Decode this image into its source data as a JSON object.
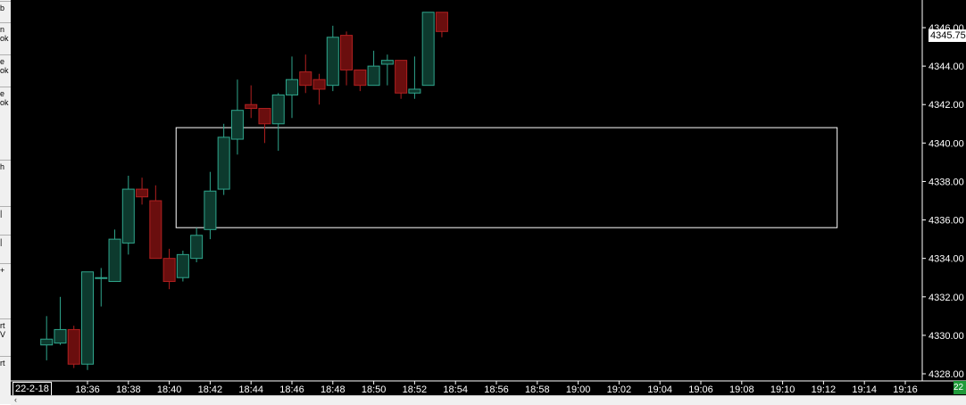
{
  "toolbar": {
    "items": [
      "b",
      "n\nok",
      "e\nok",
      "e\nok",
      "h",
      "|",
      "|",
      "+",
      "rt\nV",
      "rt"
    ]
  },
  "date_label": "22-2-18",
  "current_price_label": "4345.75",
  "corner_tag": "22",
  "colors": {
    "background": "#000000",
    "up_fill": "#0d3a2e",
    "up_border": "#2fa58c",
    "down_fill": "#6a0e0e",
    "down_border": "#b02020",
    "axis_text": "#ffffff",
    "zone_border": "#ffffff"
  },
  "chart_data": {
    "type": "candlestick",
    "title": "",
    "xlabel": "",
    "ylabel": "",
    "ylim": [
      4327.5,
      4346.5
    ],
    "x_ticks": [
      "18:36",
      "18:38",
      "18:40",
      "18:42",
      "18:44",
      "18:46",
      "18:48",
      "18:50",
      "18:52",
      "18:54",
      "18:56",
      "18:58",
      "19:00",
      "19:02",
      "19:04",
      "19:06",
      "19:08",
      "19:10",
      "19:12",
      "19:14",
      "19:16"
    ],
    "y_ticks": [
      "4328.00",
      "4330.00",
      "4332.00",
      "4334.00",
      "4336.00",
      "4338.00",
      "4340.00",
      "4342.00",
      "4344.00",
      "4346.00"
    ],
    "grid": false,
    "candles": [
      {
        "time": "18:34:00",
        "open": 4329.5,
        "high": 4331.0,
        "low": 4328.7,
        "close": 4329.8
      },
      {
        "time": "18:34:40",
        "open": 4329.6,
        "high": 4332.0,
        "low": 4329.5,
        "close": 4330.3
      },
      {
        "time": "18:35:20",
        "open": 4330.3,
        "high": 4330.5,
        "low": 4328.3,
        "close": 4328.5
      },
      {
        "time": "18:36:00",
        "open": 4328.5,
        "high": 4333.3,
        "low": 4328.2,
        "close": 4333.3
      },
      {
        "time": "18:36:40",
        "open": 4333.0,
        "high": 4333.5,
        "low": 4331.5,
        "close": 4333.0
      },
      {
        "time": "18:37:20",
        "open": 4332.8,
        "high": 4335.5,
        "low": 4332.8,
        "close": 4335.0
      },
      {
        "time": "18:38:00",
        "open": 4334.8,
        "high": 4338.3,
        "low": 4334.2,
        "close": 4337.6
      },
      {
        "time": "18:38:40",
        "open": 4337.6,
        "high": 4338.2,
        "low": 4336.8,
        "close": 4337.2
      },
      {
        "time": "18:39:20",
        "open": 4337.0,
        "high": 4337.8,
        "low": 4335.5,
        "close": 4334.0
      },
      {
        "time": "18:40:00",
        "open": 4334.0,
        "high": 4334.5,
        "low": 4332.4,
        "close": 4332.8
      },
      {
        "time": "18:40:40",
        "open": 4333.0,
        "high": 4334.4,
        "low": 4332.8,
        "close": 4334.2
      },
      {
        "time": "18:41:20",
        "open": 4334.0,
        "high": 4335.6,
        "low": 4333.8,
        "close": 4335.2
      },
      {
        "time": "18:42:00",
        "open": 4335.5,
        "high": 4338.5,
        "low": 4335.0,
        "close": 4337.5
      },
      {
        "time": "18:42:40",
        "open": 4337.6,
        "high": 4341.0,
        "low": 4337.3,
        "close": 4340.3
      },
      {
        "time": "18:43:20",
        "open": 4340.2,
        "high": 4343.3,
        "low": 4339.4,
        "close": 4341.7
      },
      {
        "time": "18:44:00",
        "open": 4342.0,
        "high": 4343.0,
        "low": 4341.3,
        "close": 4341.8
      },
      {
        "time": "18:44:40",
        "open": 4341.8,
        "high": 4341.8,
        "low": 4340.0,
        "close": 4341.0
      },
      {
        "time": "18:45:20",
        "open": 4341.0,
        "high": 4342.6,
        "low": 4339.6,
        "close": 4342.5
      },
      {
        "time": "18:46:00",
        "open": 4342.5,
        "high": 4344.5,
        "low": 4341.3,
        "close": 4343.3
      },
      {
        "time": "18:46:40",
        "open": 4343.7,
        "high": 4344.6,
        "low": 4342.6,
        "close": 4343.0
      },
      {
        "time": "18:47:20",
        "open": 4343.3,
        "high": 4343.6,
        "low": 4342.0,
        "close": 4342.8
      },
      {
        "time": "18:48:00",
        "open": 4343.0,
        "high": 4346.1,
        "low": 4342.7,
        "close": 4345.5
      },
      {
        "time": "18:48:40",
        "open": 4345.6,
        "high": 4345.8,
        "low": 4343.0,
        "close": 4343.8
      },
      {
        "time": "18:49:20",
        "open": 4343.8,
        "high": 4343.8,
        "low": 4342.7,
        "close": 4343.0
      },
      {
        "time": "18:50:00",
        "open": 4343.0,
        "high": 4344.8,
        "low": 4343.0,
        "close": 4344.0
      },
      {
        "time": "18:50:40",
        "open": 4344.1,
        "high": 4344.6,
        "low": 4343.0,
        "close": 4344.3
      },
      {
        "time": "18:51:20",
        "open": 4344.3,
        "high": 4344.3,
        "low": 4342.3,
        "close": 4342.6
      },
      {
        "time": "18:52:00",
        "open": 4342.6,
        "high": 4344.5,
        "low": 4342.3,
        "close": 4342.8
      },
      {
        "time": "18:52:40",
        "open": 4343.0,
        "high": 4346.8,
        "low": 4343.0,
        "close": 4346.8
      },
      {
        "time": "18:53:20",
        "open": 4346.8,
        "high": 4346.8,
        "low": 4345.5,
        "close": 4345.8
      }
    ],
    "zone": {
      "time_start": "18:40:20",
      "time_end": "19:12:40",
      "price_top": 4340.8,
      "price_bottom": 4335.6
    }
  }
}
